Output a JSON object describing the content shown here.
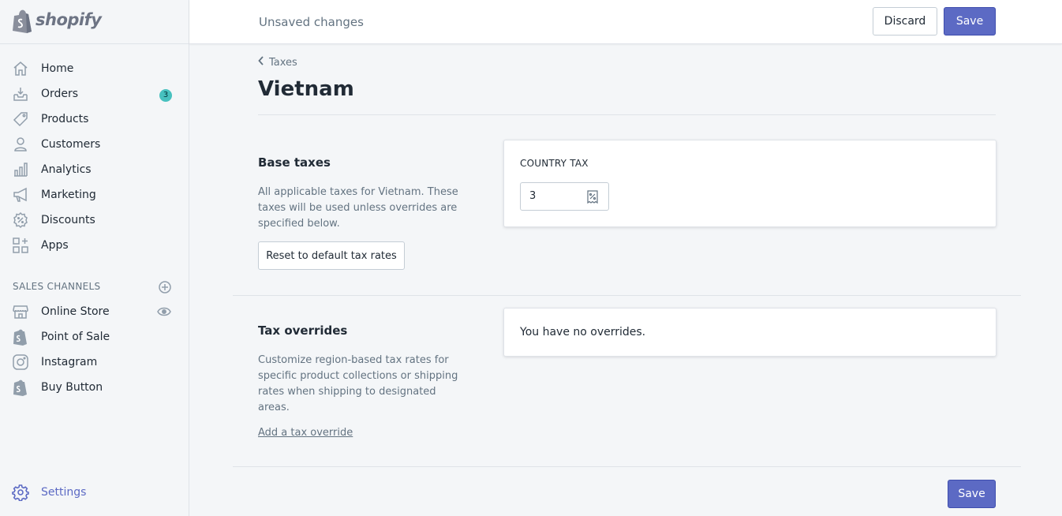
{
  "app": {
    "logo_text": "shopify"
  },
  "sidebar": {
    "items": [
      {
        "label": "Home",
        "icon": "home-icon"
      },
      {
        "label": "Orders",
        "icon": "orders-icon",
        "badge": "3"
      },
      {
        "label": "Products",
        "icon": "tag-icon"
      },
      {
        "label": "Customers",
        "icon": "person-icon"
      },
      {
        "label": "Analytics",
        "icon": "bar-chart-icon"
      },
      {
        "label": "Marketing",
        "icon": "megaphone-icon"
      },
      {
        "label": "Discounts",
        "icon": "discount-icon"
      },
      {
        "label": "Apps",
        "icon": "apps-icon"
      }
    ],
    "sales_channels_title": "SALES CHANNELS",
    "channels": [
      {
        "label": "Online Store",
        "icon": "store-icon"
      },
      {
        "label": "Point of Sale",
        "icon": "shopify-bag-icon"
      },
      {
        "label": "Instagram",
        "icon": "instagram-icon"
      },
      {
        "label": "Buy Button",
        "icon": "shopify-bag-icon"
      }
    ],
    "settings_label": "Settings"
  },
  "topbar": {
    "status": "Unsaved changes",
    "discard_label": "Discard",
    "save_label": "Save"
  },
  "page": {
    "breadcrumb": "Taxes",
    "title": "Vietnam"
  },
  "base_taxes": {
    "heading": "Base taxes",
    "description": "All applicable taxes for Vietnam. These taxes will be used unless overrides are specified below.",
    "reset_label": "Reset to default tax rates",
    "country_tax_label": "COUNTRY TAX",
    "country_tax_value": "3"
  },
  "tax_overrides": {
    "heading": "Tax overrides",
    "description": "Customize region-based tax rates for specific product collections or shipping rates when shipping to designated areas.",
    "empty_text": "You have no overrides.",
    "add_link": "Add a tax override"
  },
  "footer": {
    "save_label": "Save"
  },
  "colors": {
    "primary": "#5c6ac4",
    "badge": "#47c1bf",
    "muted": "#637381"
  }
}
